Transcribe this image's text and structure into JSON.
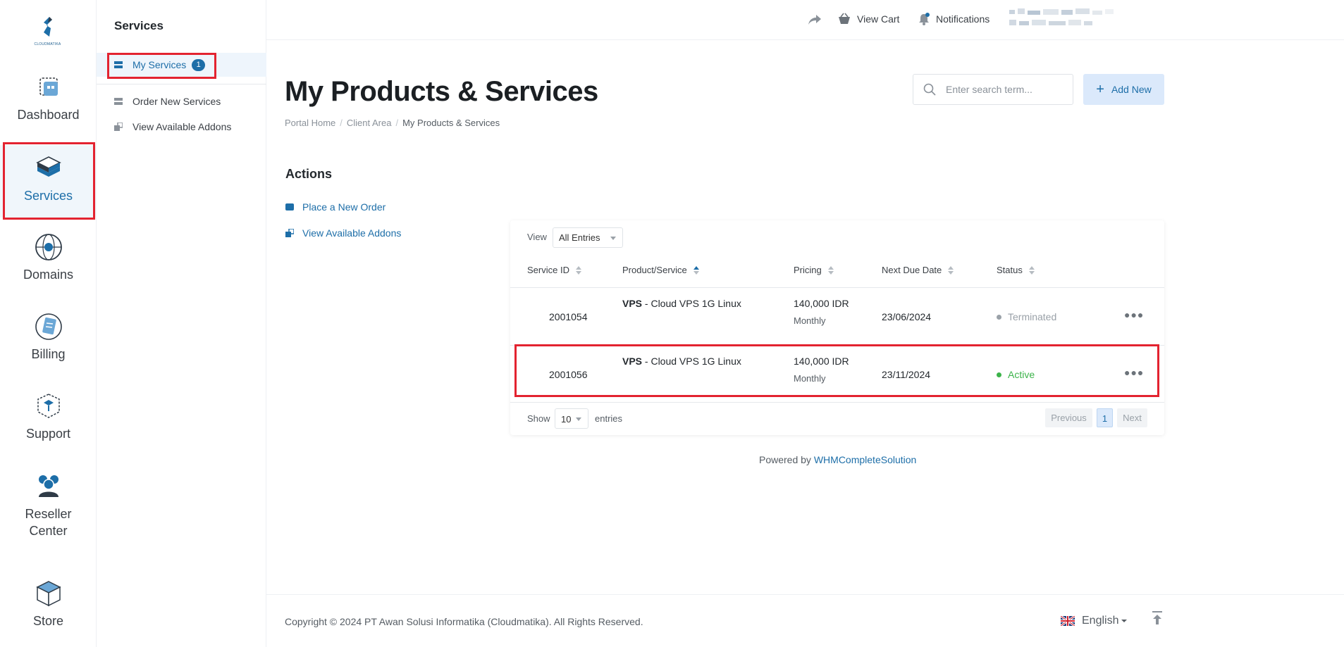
{
  "rail": {
    "logo_text": "CLOUDMATIKA",
    "items": [
      {
        "label": "Dashboard"
      },
      {
        "label": "Services"
      },
      {
        "label": "Domains"
      },
      {
        "label": "Billing"
      },
      {
        "label": "Support"
      },
      {
        "label": "Reseller",
        "label2": "Center"
      },
      {
        "label": "Store"
      }
    ]
  },
  "subnav": {
    "title": "Services",
    "items": [
      {
        "label": "My Services",
        "badge": "1"
      },
      {
        "label": "Order New Services"
      },
      {
        "label": "View Available Addons"
      }
    ]
  },
  "topbar": {
    "view_cart": "View Cart",
    "notifications": "Notifications"
  },
  "main": {
    "title": "My Products & Services",
    "breadcrumb": [
      "Portal Home",
      "Client Area",
      "My Products & Services"
    ],
    "search_placeholder": "Enter search term...",
    "add_new": "Add New",
    "actions_title": "Actions",
    "actions": [
      {
        "label": "Place a New Order"
      },
      {
        "label": "View Available Addons"
      }
    ]
  },
  "table": {
    "view_label": "View",
    "view_value": "All Entries",
    "columns": [
      "Service ID",
      "Product/Service",
      "Pricing",
      "Next Due Date",
      "Status"
    ],
    "rows": [
      {
        "id": "2001054",
        "product_bold": "VPS",
        "product_rest": " - Cloud VPS 1G Linux",
        "price": "140,000 IDR",
        "cycle": "Monthly",
        "due": "23/06/2024",
        "status": "Terminated",
        "status_color": "#9aa1a8",
        "dot_color": "#9aa1a8"
      },
      {
        "id": "2001056",
        "product_bold": "VPS",
        "product_rest": " - Cloud VPS 1G Linux",
        "price": "140,000 IDR",
        "cycle": "Monthly",
        "due": "23/11/2024",
        "status": "Active",
        "status_color": "#3cb34a",
        "dot_color": "#3cb34a"
      }
    ],
    "show_label": "Show",
    "show_value": "10",
    "entries_label": "entries",
    "pager": {
      "previous": "Previous",
      "page": "1",
      "next": "Next"
    }
  },
  "powered": {
    "prefix": "Powered by ",
    "link": "WHMCompleteSolution"
  },
  "footer": {
    "copyright": "Copyright © 2024 PT Awan Solusi Informatika (Cloudmatika). All Rights Reserved.",
    "language": "English"
  },
  "colors": {
    "accent": "#1d6ea8",
    "highlight": "#e32330"
  }
}
